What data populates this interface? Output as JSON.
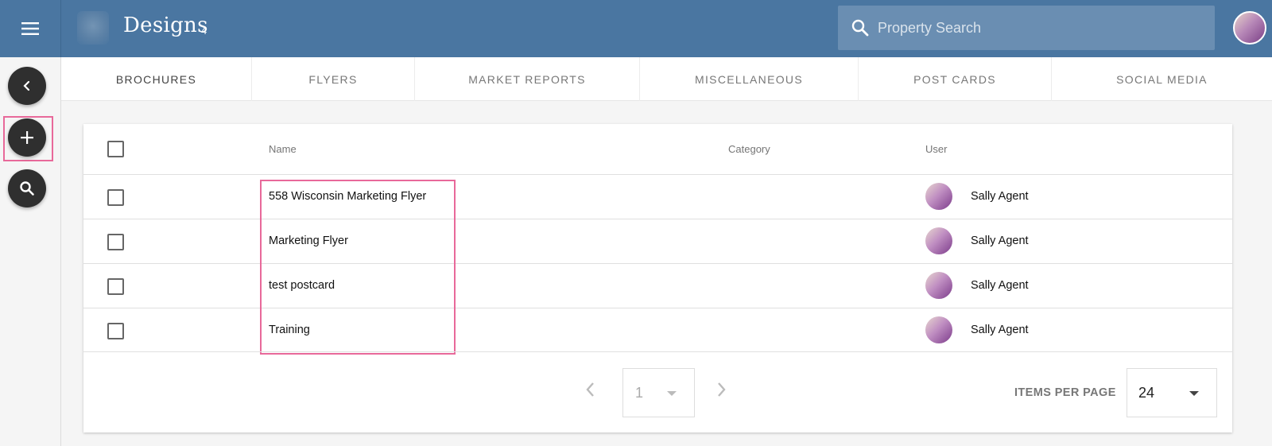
{
  "header": {
    "title": "Designs",
    "count": "4",
    "search_placeholder": "Property Search"
  },
  "icons": {
    "menu": "hamburger-menu-icon",
    "back": "chevron-left-icon",
    "add": "plus-icon",
    "search": "search-icon"
  },
  "tabs": [
    {
      "label": "BROCHURES",
      "active": true
    },
    {
      "label": "FLYERS",
      "active": false
    },
    {
      "label": "MARKET REPORTS",
      "active": false
    },
    {
      "label": "MISCELLANEOUS",
      "active": false
    },
    {
      "label": "POST CARDS",
      "active": false
    },
    {
      "label": "SOCIAL MEDIA",
      "active": false
    }
  ],
  "table": {
    "columns": {
      "name": "Name",
      "category": "Category",
      "user": "User"
    },
    "rows": [
      {
        "name": "558 Wisconsin Marketing Flyer",
        "category": "",
        "user": "Sally Agent"
      },
      {
        "name": "Marketing Flyer",
        "category": "",
        "user": "Sally Agent"
      },
      {
        "name": "test postcard",
        "category": "",
        "user": "Sally Agent"
      },
      {
        "name": "Training",
        "category": "",
        "user": "Sally Agent"
      }
    ]
  },
  "pagination": {
    "page": "1",
    "items_per_page_label": "ITEMS PER PAGE",
    "items_per_page": "24"
  },
  "colors": {
    "header": "#4a76a1",
    "fab": "#2f2f2f",
    "highlight": "#e8699a"
  }
}
